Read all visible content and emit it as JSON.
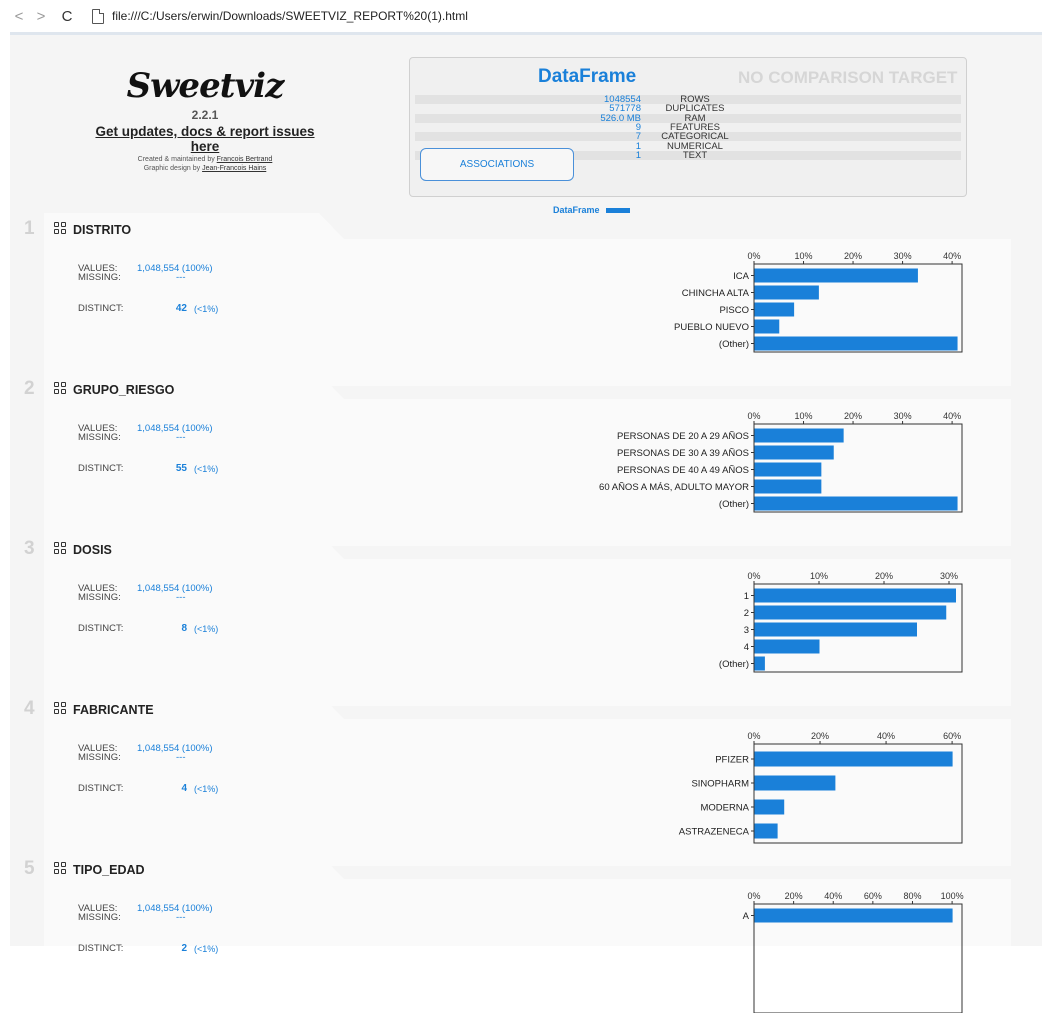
{
  "browser": {
    "back": "<",
    "forward": ">",
    "reload": "C",
    "url": "file:///C:/Users/erwin/Downloads/SWEETVIZ_REPORT%20(1).html"
  },
  "logo": {
    "name": "Sweetviz",
    "version": "2.2.1",
    "updates_link": "Get updates, docs & report issues here",
    "credit1_prefix": "Created & maintained by ",
    "credit1_link": "Francois Bertrand",
    "credit2_prefix": "Graphic design by ",
    "credit2_link": "Jean-Francois Hains"
  },
  "summary": {
    "title": "DataFrame",
    "comparison": "NO COMPARISON TARGET",
    "associations_button": "ASSOCIATIONS",
    "rows": [
      {
        "value": "1048554",
        "label": "ROWS"
      },
      {
        "value": "571778",
        "label": "DUPLICATES"
      },
      {
        "value": "526.0 MB",
        "label": "RAM"
      },
      {
        "value": "9",
        "label": "FEATURES"
      },
      {
        "value": "7",
        "label": "CATEGORICAL"
      },
      {
        "value": "1",
        "label": "NUMERICAL"
      },
      {
        "value": "1",
        "label": "TEXT"
      }
    ],
    "legend": "DataFrame"
  },
  "colors": {
    "accent": "#1a80d9",
    "bar": "#1a80d9"
  },
  "labels": {
    "values": "VALUES:",
    "missing": "MISSING:",
    "distinct": "DISTINCT:"
  },
  "features": [
    {
      "num": "1",
      "name": "DISTRITO",
      "values": "1,048,554 (100%)",
      "missing": "---",
      "distinct": "42",
      "distinct_pct": "(<1%)",
      "chart_data": {
        "type": "bar",
        "orientation": "horizontal",
        "categories": [
          "ICA",
          "CHINCHA ALTA",
          "PISCO",
          "PUEBLO NUEVO",
          "(Other)"
        ],
        "values": [
          33,
          13,
          8,
          5,
          41
        ],
        "xticks": [
          "0%",
          "10%",
          "20%",
          "30%",
          "40%"
        ],
        "xlim": [
          0,
          42
        ]
      }
    },
    {
      "num": "2",
      "name": "GRUPO_RIESGO",
      "values": "1,048,554 (100%)",
      "missing": "---",
      "distinct": "55",
      "distinct_pct": "(<1%)",
      "chart_data": {
        "type": "bar",
        "orientation": "horizontal",
        "categories": [
          "PERSONAS DE 20  A 29 AÑOS",
          "PERSONAS DE 30 A 39 AÑOS",
          "PERSONAS DE 40 A 49 AÑOS",
          "60 AÑOS A MÁS, ADULTO MAYOR",
          "(Other)"
        ],
        "values": [
          18,
          16,
          13.5,
          13.5,
          41
        ],
        "xticks": [
          "0%",
          "10%",
          "20%",
          "30%",
          "40%"
        ],
        "xlim": [
          0,
          42
        ]
      }
    },
    {
      "num": "3",
      "name": "DOSIS",
      "values": "1,048,554 (100%)",
      "missing": "---",
      "distinct": "8",
      "distinct_pct": "(<1%)",
      "chart_data": {
        "type": "bar",
        "orientation": "horizontal",
        "categories": [
          "1",
          "2",
          "3",
          "4",
          "(Other)"
        ],
        "values": [
          31,
          29.5,
          25,
          10,
          1.6
        ],
        "xticks": [
          "0%",
          "10%",
          "20%",
          "30%"
        ],
        "xlim": [
          0,
          32
        ]
      }
    },
    {
      "num": "4",
      "name": "FABRICANTE",
      "values": "1,048,554 (100%)",
      "missing": "---",
      "distinct": "4",
      "distinct_pct": "(<1%)",
      "chart_data": {
        "type": "bar",
        "orientation": "horizontal",
        "categories": [
          "PFIZER",
          "SINOPHARM",
          "MODERNA",
          "ASTRAZENECA"
        ],
        "values": [
          60,
          24.5,
          9,
          7
        ],
        "xticks": [
          "0%",
          "20%",
          "40%",
          "60%"
        ],
        "xlim": [
          0,
          63
        ]
      }
    },
    {
      "num": "5",
      "name": "TIPO_EDAD",
      "values": "1,048,554 (100%)",
      "missing": "---",
      "distinct": "2",
      "distinct_pct": "(<1%)",
      "chart_data": {
        "type": "bar",
        "orientation": "horizontal",
        "categories": [
          "A"
        ],
        "values": [
          100
        ],
        "xticks": [
          "0%",
          "20%",
          "40%",
          "60%",
          "80%",
          "100%"
        ],
        "xlim": [
          0,
          105
        ]
      }
    }
  ]
}
